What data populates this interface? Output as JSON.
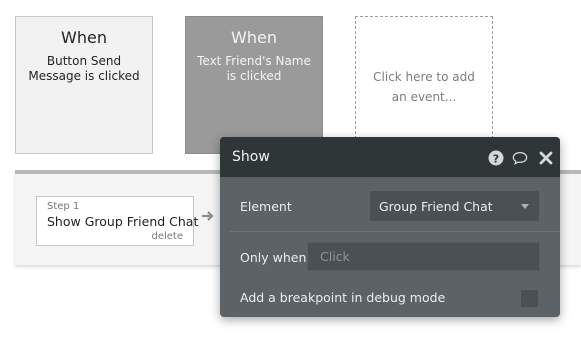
{
  "events": [
    {
      "title": "When",
      "description": "Button Send Message is clicked"
    },
    {
      "title": "When",
      "description": "Text Friend's Name is clicked"
    }
  ],
  "add_event": "Click here to add an event...",
  "workflow": {
    "step_number": "Step 1",
    "step_name": "Show Group Friend Chat",
    "delete_label": "delete"
  },
  "panel": {
    "title": "Show",
    "icons": [
      "help-icon",
      "comment-icon",
      "close-icon"
    ],
    "element_label": "Element",
    "element_value": "Group Friend Chat",
    "only_when_label": "Only when",
    "only_when_placeholder": "Click",
    "breakpoint_label": "Add a breakpoint in debug mode"
  }
}
